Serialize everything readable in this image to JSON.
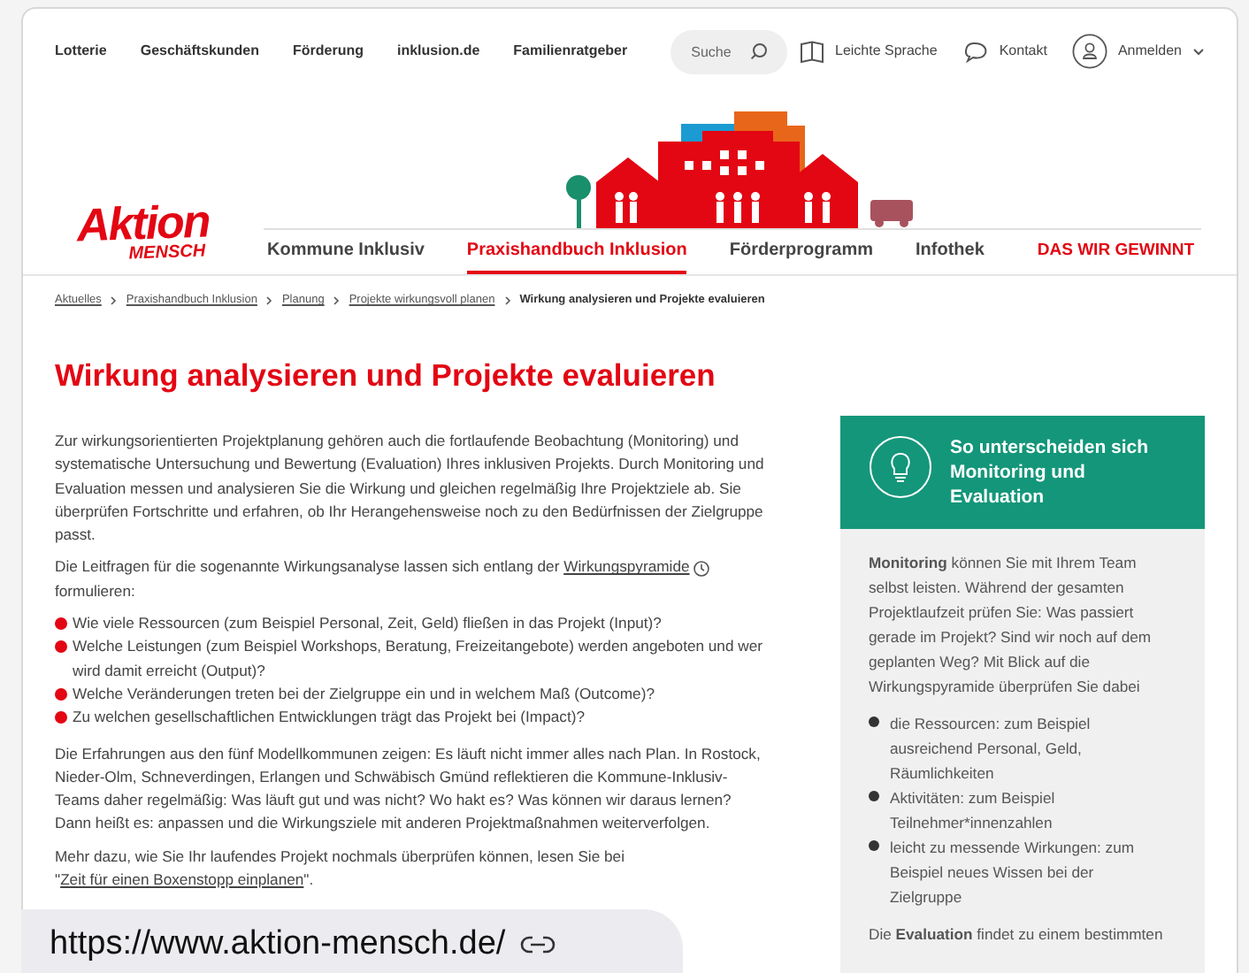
{
  "top_links": [
    "Lotterie",
    "Geschäftskunden",
    "Förderung",
    "inklusion.de",
    "Familienratgeber"
  ],
  "search": {
    "placeholder": "Suche"
  },
  "utility_links": [
    {
      "kind": "easy",
      "label": "Leichte Sprache"
    },
    {
      "kind": "contact",
      "label": "Kontakt"
    },
    {
      "kind": "login",
      "label": "Anmelden"
    }
  ],
  "logo": {
    "line_1": "Aktion",
    "line_2": "MENSCH"
  },
  "main_nav": [
    {
      "label": "Kommune Inklusiv",
      "selected": false,
      "kind": "normal"
    },
    {
      "label": "Praxishandbuch Inklusion",
      "selected": true,
      "kind": "normal"
    },
    {
      "label": "Förderprogramm",
      "selected": false,
      "kind": "normal"
    },
    {
      "label": "Infothek",
      "selected": false,
      "kind": "normal"
    },
    {
      "label": "DAS WIR GEWINNT",
      "selected": false,
      "kind": "highlight"
    }
  ],
  "breadcrumb": [
    "Aktuelles",
    "Praxishandbuch Inklusion",
    "Planung",
    "Projekte wirkungsvoll planen",
    "Wirkung analysieren und Projekte evaluieren"
  ],
  "title": "Wirkung analysieren und Projekte evaluieren",
  "intro": "Zur wirkungsorientierten Projektplanung gehören auch die fortlaufende Beobachtung (Monitoring) und systematische Untersuchung und Bewertung (Evaluation) Ihres inklusiven Projekts. Durch Monitoring und Evaluation messen und analysieren Sie die Wirkung und gleichen regelmäßig Ihre Projektziele ab. Sie überprüfen Fortschritte und erfahren, ob Ihr Herangehensweise noch zu den Bedürfnissen der Zielgruppe passt.",
  "lead": {
    "before": "Die Leitfragen für die sogenannte Wirkungsanalyse lassen sich entlang der",
    "link": "Wirkungspyramide",
    "after": "formulieren:"
  },
  "questions": [
    "Wie viele Ressourcen (zum Beispiel Personal, Zeit, Geld) fließen in das Projekt (Input)?",
    "Welche Leistungen (zum Beispiel Workshops, Beratung, Freizeitangebote) werden angeboten und wer wird damit erreicht (Output)?",
    "Welche Veränderungen treten bei der Zielgruppe ein und in welchem Maß (Outcome)?",
    "Zu welchen gesellschaftlichen Entwicklungen trägt das Projekt bei (Impact)?"
  ],
  "experience": "Die Erfahrungen aus den fünf Modellkommunen zeigen: Es läuft nicht immer alles nach Plan. In Rostock, Nieder-Olm, Schneverdingen, Erlangen und Schwäbisch Gmünd reflektieren die Kommune-Inklusiv-Teams daher regelmäßig: Was läuft gut und was nicht? Wo hakt es? Was können wir daraus lernen? Dann heißt es: anpassen und die Wirkungsziele mit anderen Projektmaßnahmen weiterverfolgen.",
  "more": {
    "before": "Mehr dazu, wie Sie Ihr laufendes Projekt nochmals überprüfen können, lesen Sie bei \"",
    "link": "Zeit für einen Boxenstopp einplanen",
    "after": "\"."
  },
  "sidebar": {
    "title": "So unterscheiden sich Monitoring und Evaluation",
    "text": "**Monitoring** können Sie mit Ihrem Team selbst leisten. Während der gesamten Projektlaufzeit prüfen Sie: Was passiert gerade im Projekt? Sind wir noch auf dem geplanten Weg? Mit Blick auf die Wirkungspyramide überprüfen Sie dabei",
    "items": [
      "die Ressourcen: zum Beispiel ausreichend Personal, Geld, Räumlichkeiten",
      "Aktivitäten: zum Beispiel Teilnehmer*innenzahlen",
      "leicht zu messende Wirkungen: zum Beispiel neues Wissen bei der Zielgruppe"
    ],
    "text_2": "Die **Evaluation** findet zu einem bestimmten"
  },
  "url_overlay": "https://www.aktion-mensch.de/"
}
